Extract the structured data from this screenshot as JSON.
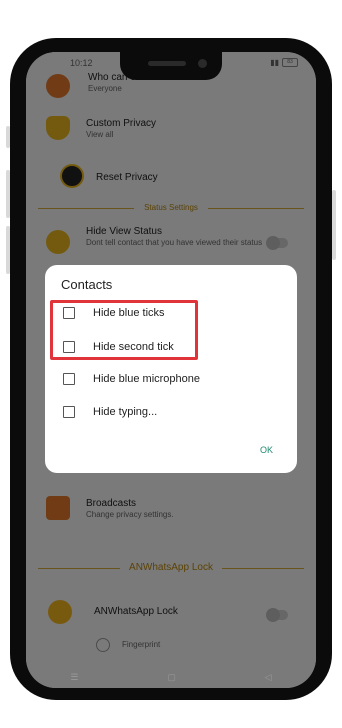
{
  "status_bar": {
    "time": "10:12",
    "battery": "83"
  },
  "background_list": {
    "who_can_call": {
      "title": "Who can call me?",
      "subtitle": "Everyone"
    },
    "custom_privacy": {
      "title": "Custom Privacy",
      "subtitle": "View all"
    },
    "reset_privacy": {
      "title": "Reset Privacy"
    },
    "status_settings_header": "Status Settings",
    "hide_view_status": {
      "title": "Hide View Status",
      "subtitle": "Dont tell contact that you have viewed their status"
    },
    "broadcasts": {
      "title": "Broadcasts",
      "subtitle": "Change privacy settings."
    },
    "lock_header": "ANWhatsApp Lock",
    "lock_row": {
      "title": "ANWhatsApp Lock"
    },
    "fingerprint": {
      "title": "Fingerprint"
    }
  },
  "dialog": {
    "title": "Contacts",
    "options": [
      {
        "label": "Hide blue ticks",
        "checked": false
      },
      {
        "label": "Hide second tick",
        "checked": false
      },
      {
        "label": "Hide blue microphone",
        "checked": false
      },
      {
        "label": "Hide typing...",
        "checked": false
      }
    ],
    "ok_label": "OK"
  },
  "colors": {
    "accent": "#1f8a70",
    "highlight": "#e0343a",
    "section_gold": "#d4a93a"
  }
}
